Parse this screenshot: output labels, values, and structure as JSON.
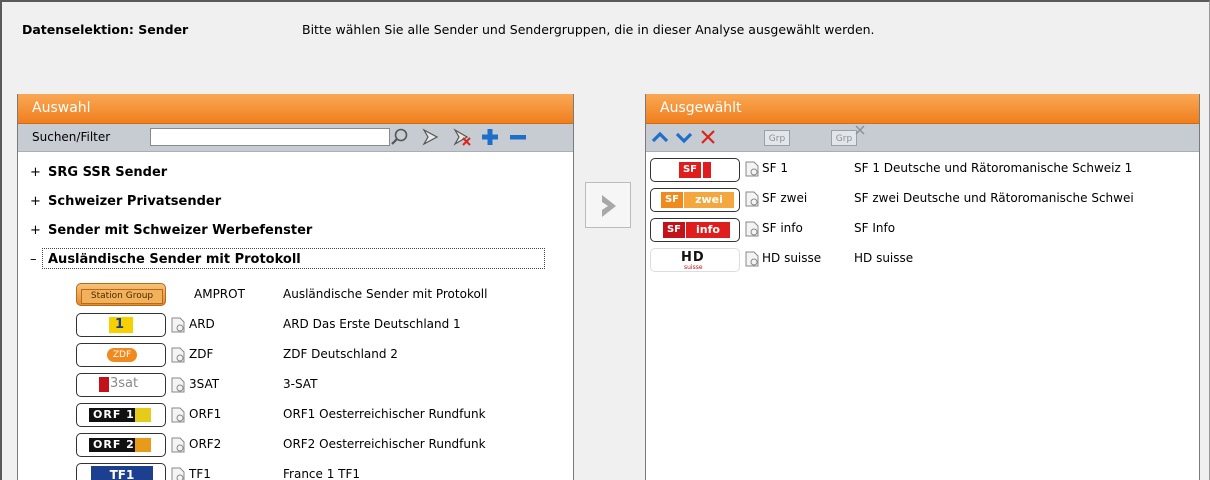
{
  "header": {
    "title": "Datenselektion: Sender",
    "description": "Bitte wählen Sie alle Sender und Sendergruppen, die in dieser Analyse ausgewählt werden."
  },
  "left_panel": {
    "title": "Auswahl",
    "search_label": "Suchen/Filter",
    "search_value": "",
    "groups": [
      {
        "expander": "+",
        "label": "SRG SSR Sender"
      },
      {
        "expander": "+",
        "label": "Schweizer Privatsender"
      },
      {
        "expander": "+",
        "label": "Sender mit Schweizer Werbefenster"
      },
      {
        "expander": "–",
        "label": "Ausländische Sender mit Protokoll"
      }
    ],
    "children": [
      {
        "logo": "Station Group",
        "code": "AMPROT",
        "name": "Ausländische Sender mit Protokoll"
      },
      {
        "logo": "ARD",
        "code": "ARD",
        "name": "ARD Das Erste Deutschland 1"
      },
      {
        "logo": "ZDF",
        "code": "ZDF",
        "name": "ZDF Deutschland 2"
      },
      {
        "logo": "3sat",
        "code": "3SAT",
        "name": "3-SAT"
      },
      {
        "logo": "ORF 1",
        "code": "ORF1",
        "name": "ORF1 Oesterreichischer Rundfunk"
      },
      {
        "logo": "ORF 2",
        "code": "ORF2",
        "name": "ORF2 Oesterreichischer Rundfunk"
      },
      {
        "logo": "TF1",
        "code": "TF1",
        "name": "France 1 TF1"
      }
    ]
  },
  "right_panel": {
    "title": "Ausgewählt",
    "toolbar_buttons": [
      "Grp",
      "Grp"
    ],
    "items": [
      {
        "logo": "SF 1",
        "code": "SF 1",
        "name": "SF 1 Deutsche und Rätoromanische Schweiz 1"
      },
      {
        "logo": "SF zwei",
        "code": "SF zwei",
        "name": "SF zwei Deutsche und Rätoromanische Schwei"
      },
      {
        "logo": "SF info",
        "code": "SF info",
        "name": "SF Info"
      },
      {
        "logo": "HD suisse",
        "code": "HD suisse",
        "name": "HD suisse"
      }
    ]
  },
  "colors": {
    "accent": "#f07f1e",
    "toolbar": "#c6ccd2",
    "icon_blue": "#1f6fc9",
    "icon_red": "#d9261c"
  }
}
